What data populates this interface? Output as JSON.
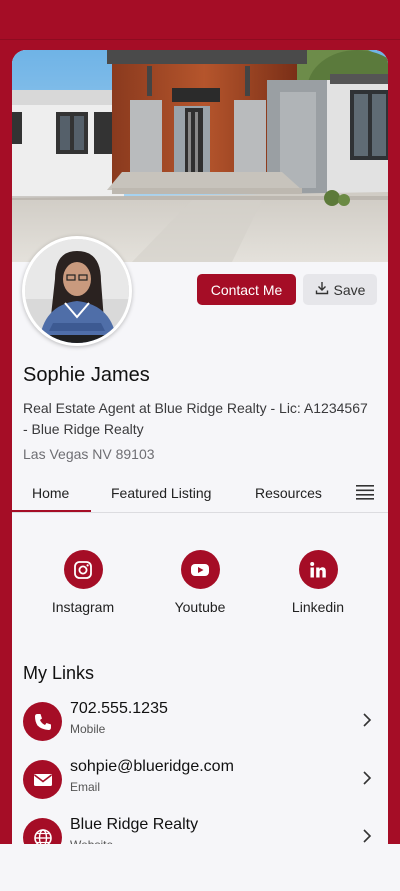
{
  "profile": {
    "name": "Sophie James",
    "title": "Real Estate Agent at Blue Ridge Realty - Lic: A1234567 - Blue Ridge Realty",
    "location": "Las Vegas NV 89103"
  },
  "actions": {
    "contact_label": "Contact Me",
    "save_label": "Save"
  },
  "tabs": [
    {
      "label": "Home",
      "active": true
    },
    {
      "label": "Featured Listing",
      "active": false
    },
    {
      "label": "Resources",
      "active": false
    }
  ],
  "social": [
    {
      "label": "Instagram",
      "icon": "instagram-icon"
    },
    {
      "label": "Youtube",
      "icon": "youtube-icon"
    },
    {
      "label": "Linkedin",
      "icon": "linkedin-icon"
    }
  ],
  "links": {
    "heading": "My Links",
    "items": [
      {
        "title": "702.555.1235",
        "subtitle": "Mobile",
        "icon": "phone-icon"
      },
      {
        "title": "sohpie@blueridge.com",
        "subtitle": "Email",
        "icon": "envelope-icon"
      },
      {
        "title": "Blue Ridge Realty",
        "subtitle": "Website",
        "icon": "globe-icon"
      }
    ]
  },
  "colors": {
    "brand": "#a50d26",
    "background": "#f6f6f9"
  }
}
